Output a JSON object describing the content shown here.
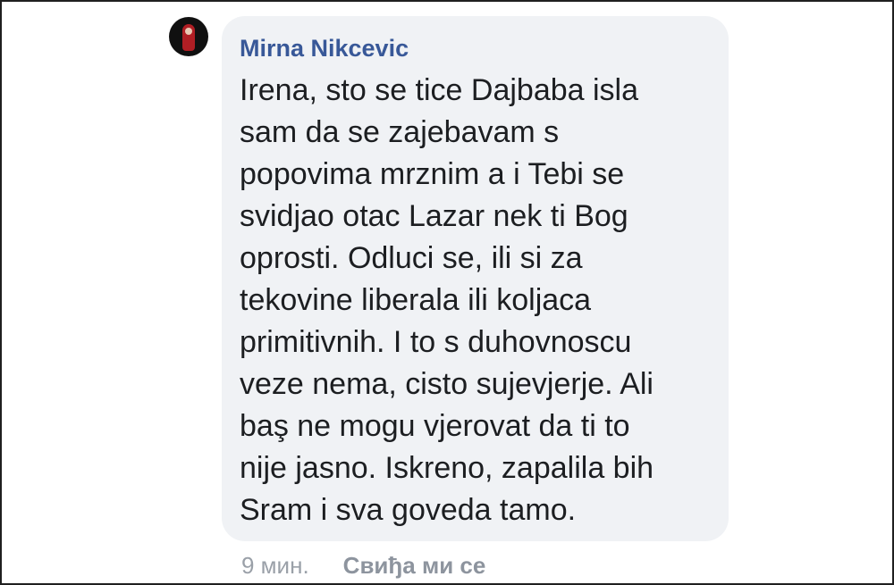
{
  "comment": {
    "author": "Mirna Nikcevic",
    "avatar_icon": "profile-photo-icon",
    "text_lines": [
      "Irena, sto se tice Dajbaba isla",
      "sam da se zajebavam s",
      "popovima mrznim a i Tebi se",
      "svidjao otac Lazar nek ti Bog",
      "oprosti. Odluci se, ili si za",
      "tekovine liberala ili koljaca",
      "primitivnih. I to s duhovnoscu",
      "veze nema, cisto sujevjerje. Ali",
      "baş ne mogu vjerovat da ti to",
      "nije jasno. Iskreno, zapalila bih",
      "Sram i sva goveda tamo."
    ],
    "timestamp": "9 мин.",
    "like_label": "Свиђа ми се"
  },
  "colors": {
    "bubble_background": "#f0f2f5",
    "author_name": "#385898",
    "text": "#1c1e21",
    "meta": "#8d949e"
  }
}
